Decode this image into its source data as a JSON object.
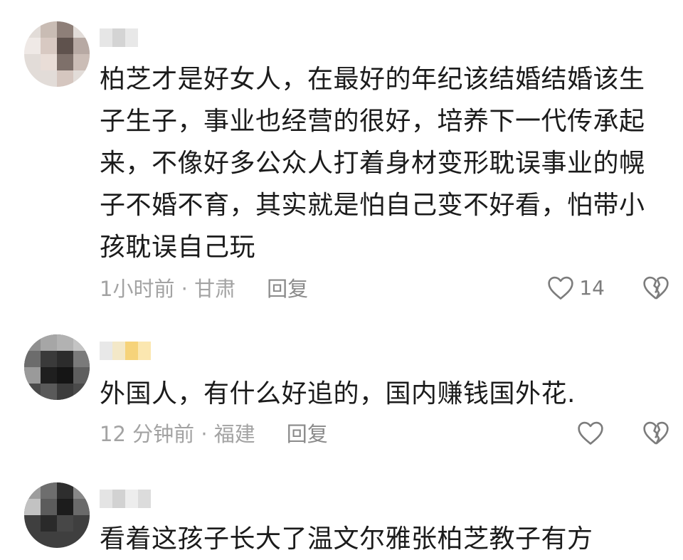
{
  "comments": [
    {
      "text": "柏芝才是好女人，在最好的年纪该结婚结婚该生子生子，事业也经营的很好，培养下一代传承起来，不像好多公众人打着身材变形耽误事业的幌子不婚不育，其实就是怕自己变不好看，怕带小孩耽误自己玩",
      "time_location": "1小时前 · 甘肃",
      "reply_label": "回复",
      "likes": "14"
    },
    {
      "text": "外国人，有什么好追的，国内赚钱国外花.",
      "time_location": "12 分钟前 · 福建",
      "reply_label": "回复",
      "likes": ""
    },
    {
      "text": "看着这孩子长大了温文尔雅张柏芝教子有方"
    }
  ],
  "icons": {
    "like": "heart-outline-icon",
    "dislike": "broken-heart-icon"
  },
  "colors": {
    "text": "#1b1b1b",
    "meta": "#a3a3a3",
    "icon": "#7c7c7c"
  }
}
